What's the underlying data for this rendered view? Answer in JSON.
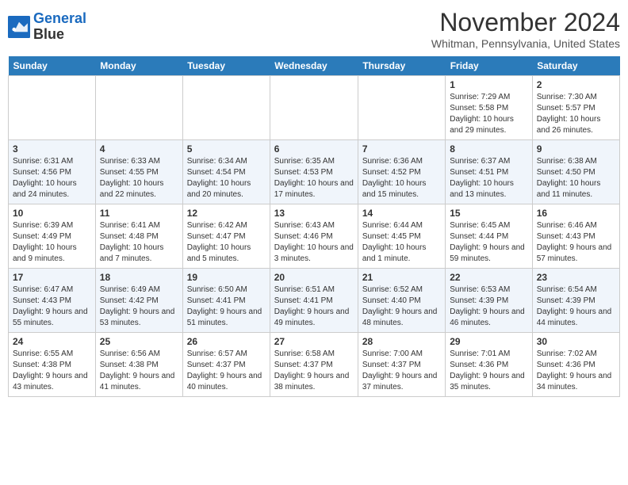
{
  "header": {
    "logo_line1": "General",
    "logo_line2": "Blue",
    "month": "November 2024",
    "location": "Whitman, Pennsylvania, United States"
  },
  "days_of_week": [
    "Sunday",
    "Monday",
    "Tuesday",
    "Wednesday",
    "Thursday",
    "Friday",
    "Saturday"
  ],
  "weeks": [
    [
      {
        "day": "",
        "info": ""
      },
      {
        "day": "",
        "info": ""
      },
      {
        "day": "",
        "info": ""
      },
      {
        "day": "",
        "info": ""
      },
      {
        "day": "",
        "info": ""
      },
      {
        "day": "1",
        "info": "Sunrise: 7:29 AM\nSunset: 5:58 PM\nDaylight: 10 hours and 29 minutes."
      },
      {
        "day": "2",
        "info": "Sunrise: 7:30 AM\nSunset: 5:57 PM\nDaylight: 10 hours and 26 minutes."
      }
    ],
    [
      {
        "day": "3",
        "info": "Sunrise: 6:31 AM\nSunset: 4:56 PM\nDaylight: 10 hours and 24 minutes."
      },
      {
        "day": "4",
        "info": "Sunrise: 6:33 AM\nSunset: 4:55 PM\nDaylight: 10 hours and 22 minutes."
      },
      {
        "day": "5",
        "info": "Sunrise: 6:34 AM\nSunset: 4:54 PM\nDaylight: 10 hours and 20 minutes."
      },
      {
        "day": "6",
        "info": "Sunrise: 6:35 AM\nSunset: 4:53 PM\nDaylight: 10 hours and 17 minutes."
      },
      {
        "day": "7",
        "info": "Sunrise: 6:36 AM\nSunset: 4:52 PM\nDaylight: 10 hours and 15 minutes."
      },
      {
        "day": "8",
        "info": "Sunrise: 6:37 AM\nSunset: 4:51 PM\nDaylight: 10 hours and 13 minutes."
      },
      {
        "day": "9",
        "info": "Sunrise: 6:38 AM\nSunset: 4:50 PM\nDaylight: 10 hours and 11 minutes."
      }
    ],
    [
      {
        "day": "10",
        "info": "Sunrise: 6:39 AM\nSunset: 4:49 PM\nDaylight: 10 hours and 9 minutes."
      },
      {
        "day": "11",
        "info": "Sunrise: 6:41 AM\nSunset: 4:48 PM\nDaylight: 10 hours and 7 minutes."
      },
      {
        "day": "12",
        "info": "Sunrise: 6:42 AM\nSunset: 4:47 PM\nDaylight: 10 hours and 5 minutes."
      },
      {
        "day": "13",
        "info": "Sunrise: 6:43 AM\nSunset: 4:46 PM\nDaylight: 10 hours and 3 minutes."
      },
      {
        "day": "14",
        "info": "Sunrise: 6:44 AM\nSunset: 4:45 PM\nDaylight: 10 hours and 1 minute."
      },
      {
        "day": "15",
        "info": "Sunrise: 6:45 AM\nSunset: 4:44 PM\nDaylight: 9 hours and 59 minutes."
      },
      {
        "day": "16",
        "info": "Sunrise: 6:46 AM\nSunset: 4:43 PM\nDaylight: 9 hours and 57 minutes."
      }
    ],
    [
      {
        "day": "17",
        "info": "Sunrise: 6:47 AM\nSunset: 4:43 PM\nDaylight: 9 hours and 55 minutes."
      },
      {
        "day": "18",
        "info": "Sunrise: 6:49 AM\nSunset: 4:42 PM\nDaylight: 9 hours and 53 minutes."
      },
      {
        "day": "19",
        "info": "Sunrise: 6:50 AM\nSunset: 4:41 PM\nDaylight: 9 hours and 51 minutes."
      },
      {
        "day": "20",
        "info": "Sunrise: 6:51 AM\nSunset: 4:41 PM\nDaylight: 9 hours and 49 minutes."
      },
      {
        "day": "21",
        "info": "Sunrise: 6:52 AM\nSunset: 4:40 PM\nDaylight: 9 hours and 48 minutes."
      },
      {
        "day": "22",
        "info": "Sunrise: 6:53 AM\nSunset: 4:39 PM\nDaylight: 9 hours and 46 minutes."
      },
      {
        "day": "23",
        "info": "Sunrise: 6:54 AM\nSunset: 4:39 PM\nDaylight: 9 hours and 44 minutes."
      }
    ],
    [
      {
        "day": "24",
        "info": "Sunrise: 6:55 AM\nSunset: 4:38 PM\nDaylight: 9 hours and 43 minutes."
      },
      {
        "day": "25",
        "info": "Sunrise: 6:56 AM\nSunset: 4:38 PM\nDaylight: 9 hours and 41 minutes."
      },
      {
        "day": "26",
        "info": "Sunrise: 6:57 AM\nSunset: 4:37 PM\nDaylight: 9 hours and 40 minutes."
      },
      {
        "day": "27",
        "info": "Sunrise: 6:58 AM\nSunset: 4:37 PM\nDaylight: 9 hours and 38 minutes."
      },
      {
        "day": "28",
        "info": "Sunrise: 7:00 AM\nSunset: 4:37 PM\nDaylight: 9 hours and 37 minutes."
      },
      {
        "day": "29",
        "info": "Sunrise: 7:01 AM\nSunset: 4:36 PM\nDaylight: 9 hours and 35 minutes."
      },
      {
        "day": "30",
        "info": "Sunrise: 7:02 AM\nSunset: 4:36 PM\nDaylight: 9 hours and 34 minutes."
      }
    ]
  ]
}
